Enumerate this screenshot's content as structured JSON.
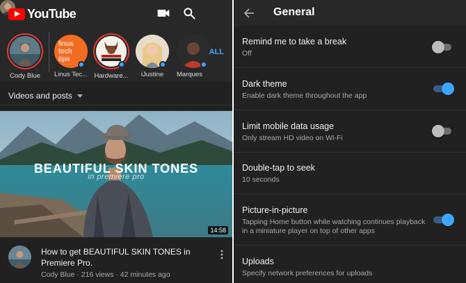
{
  "youtube": {
    "logo_text": "YouTube",
    "icons": {
      "camera": "video-camera-icon",
      "search": "search-icon",
      "account": "account-avatar"
    },
    "subscriptions": [
      {
        "name": "Cody Blue",
        "color": "#4d6470",
        "ring": true,
        "new": false
      },
      {
        "name": "Linus Tec...",
        "color": "#f36c21",
        "ring": false,
        "new": true,
        "logo": "linus tech tips"
      },
      {
        "name": "Hardware...",
        "color": "#f5f5f5",
        "ring": true,
        "new": true,
        "logo": "HARDWARE CANUCKS"
      },
      {
        "name": "iJustine",
        "color": "#d9c7b0",
        "ring": false,
        "new": true
      },
      {
        "name": "Marques",
        "color": "#3b3b3b",
        "ring": false,
        "new": true
      }
    ],
    "all_label": "ALL",
    "filter_label": "Videos and posts",
    "video": {
      "thumb_title": "BEAUTIFUL SKIN TONES",
      "thumb_subtitle": "in premiere pro",
      "duration": "14:58",
      "title": "How to get BEAUTIFUL SKIN TONES in Premiere Pro.",
      "meta": "Cody Blue · 216 views · 42 minutes ago"
    },
    "colors": {
      "brand": "#ff0000",
      "accent": "#3ea6ff",
      "background": "#212121",
      "header": "#282828"
    }
  },
  "settings": {
    "title": "General",
    "items": [
      {
        "title": "Remind me to take a break",
        "desc": "Off",
        "toggle": "off"
      },
      {
        "title": "Dark theme",
        "desc": "Enable dark theme throughout the app",
        "toggle": "on"
      },
      {
        "title": "Limit mobile data usage",
        "desc": "Only stream HD video on Wi-Fi",
        "toggle": "off"
      },
      {
        "title": "Double-tap to seek",
        "desc": "10 seconds",
        "toggle": null
      },
      {
        "title": "Picture-in-picture",
        "desc": "Tapping Home button while watching continues playback in a miniature player on top of other apps",
        "toggle": "on"
      },
      {
        "title": "Uploads",
        "desc": "Specify network preferences for uploads",
        "toggle": null
      }
    ]
  }
}
